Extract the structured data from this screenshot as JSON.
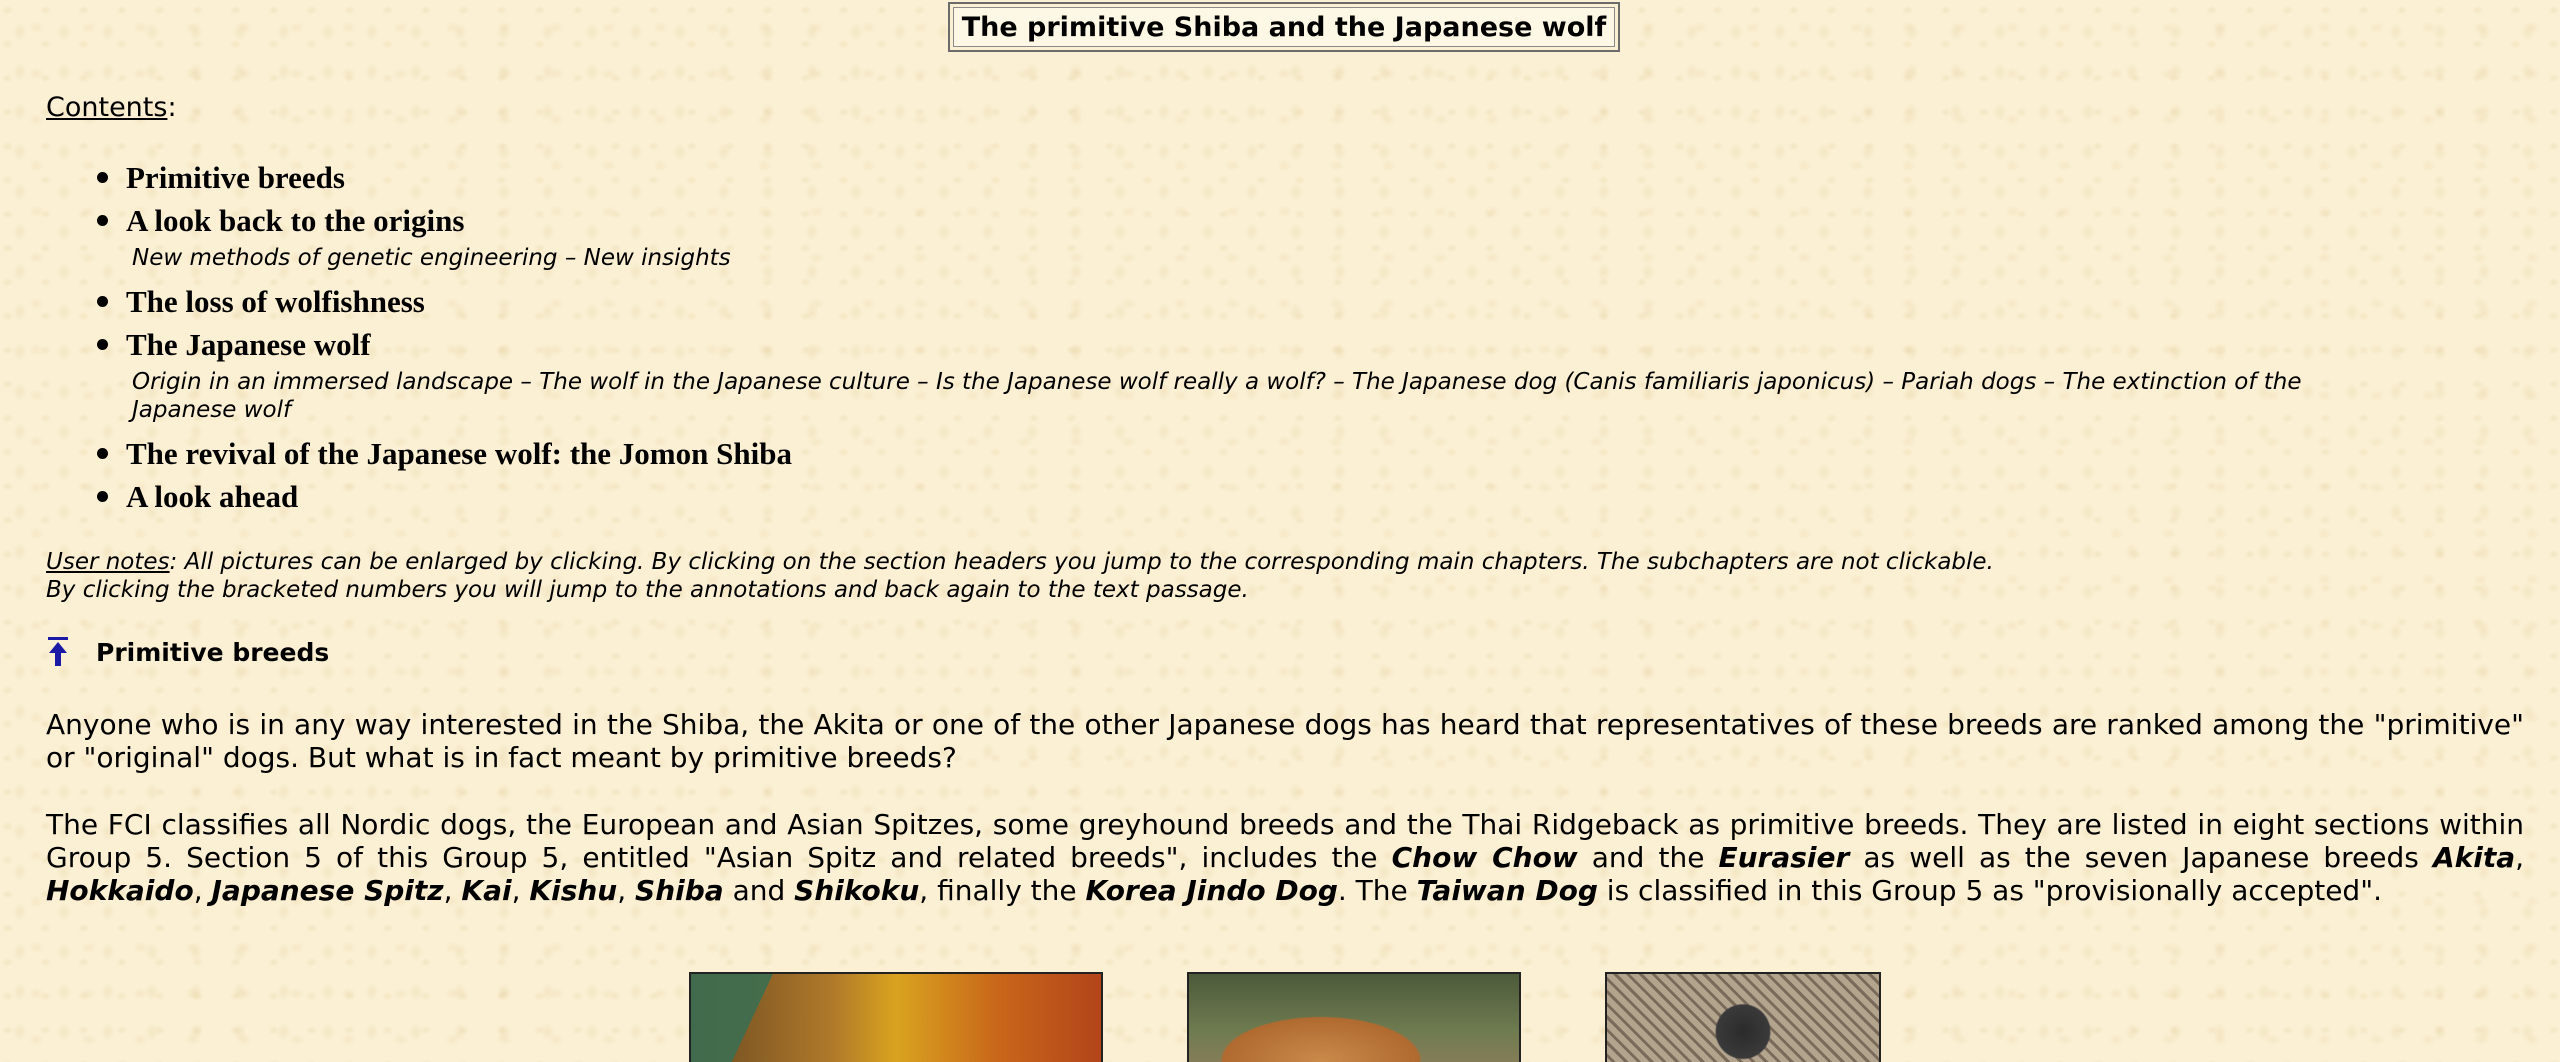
{
  "page": {
    "title": "The primitive Shiba and the Japanese wolf"
  },
  "contents": {
    "label": "Contents",
    "colon": ":",
    "items": [
      {
        "label": "Primitive breeds",
        "sub": ""
      },
      {
        "label": "A look back to the origins",
        "sub": "New methods of genetic engineering – New insights"
      },
      {
        "label": "The loss of wolfishness",
        "sub": ""
      },
      {
        "label": "The Japanese wolf",
        "sub": "Origin in an immersed landscape – The wolf in the Japanese culture – Is the Japanese wolf really a wolf? – The Japanese dog (Canis familiaris japonicus) – Pariah dogs – The extinction of the Japanese wolf"
      },
      {
        "label": "The revival of the Japanese wolf: the Jomon Shiba",
        "sub": ""
      },
      {
        "label": "A look ahead",
        "sub": ""
      }
    ]
  },
  "notes": {
    "label": "User notes",
    "text1": ": All pictures can be enlarged by clicking. By clicking on the section headers you jump to the corresponding main chapters. The subchapters are not clickable.",
    "text2": "By clicking the bracketed numbers you will jump to the annotations and back again to the text passage."
  },
  "section": {
    "icon": "up-arrow-icon",
    "title": "Primitive breeds"
  },
  "paragraph1": "Anyone who is in any way interested in the Shiba, the Akita or one of the other Japanese dogs has heard that representatives of these breeds are ranked among the \"primitive\" or \"original\" dogs. But what is in fact meant by primitive breeds?",
  "paragraph2": {
    "p1": "The FCI classifies all Nordic dogs, the European and Asian Spitzes, some greyhound breeds and the Thai Ridgeback as primitive breeds. They are listed in eight sections within Group 5. Section 5 of this Group 5, entitled \"Asian Spitz and related breeds\", includes the ",
    "b1": "Chow Chow",
    "p2": " and the ",
    "b2": "Eurasier",
    "p3": " as well as the seven Japanese breeds ",
    "b3": "Akita",
    "p4": ", ",
    "b4": "Hokkaido",
    "p5": ", ",
    "b5": "Japanese Spitz",
    "p6": ", ",
    "b6": "Kai",
    "p7": ", ",
    "b7": "Kishu",
    "p8": ", ",
    "b8": "Shiba",
    "p9": " and ",
    "b9": "Shikoku",
    "p10": ", finally the ",
    "b10": "Korea Jindo Dog",
    "p11": ". The ",
    "b11": "Taiwan Dog",
    "p12": " is classified in this Group 5 as \"provisionally accepted\"."
  },
  "colors": {
    "background": "#fbf0d4",
    "link_icon": "#1a1aa6"
  }
}
